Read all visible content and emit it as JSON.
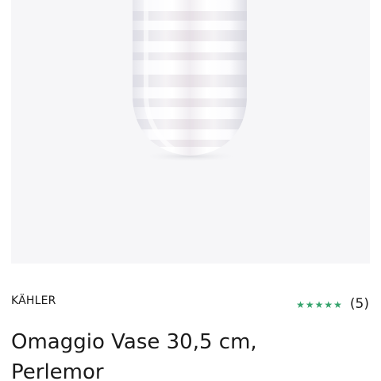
{
  "product": {
    "brand": "KÄHLER",
    "title": "Omaggio Vase 30,5 cm, Perlemor",
    "rating": {
      "stars": 5,
      "max_stars": 5,
      "count_label": "(5)",
      "star_color": "#35a36c"
    }
  },
  "colors": {
    "text": "#1b1b1b",
    "image_background": "#f6f6f8"
  }
}
